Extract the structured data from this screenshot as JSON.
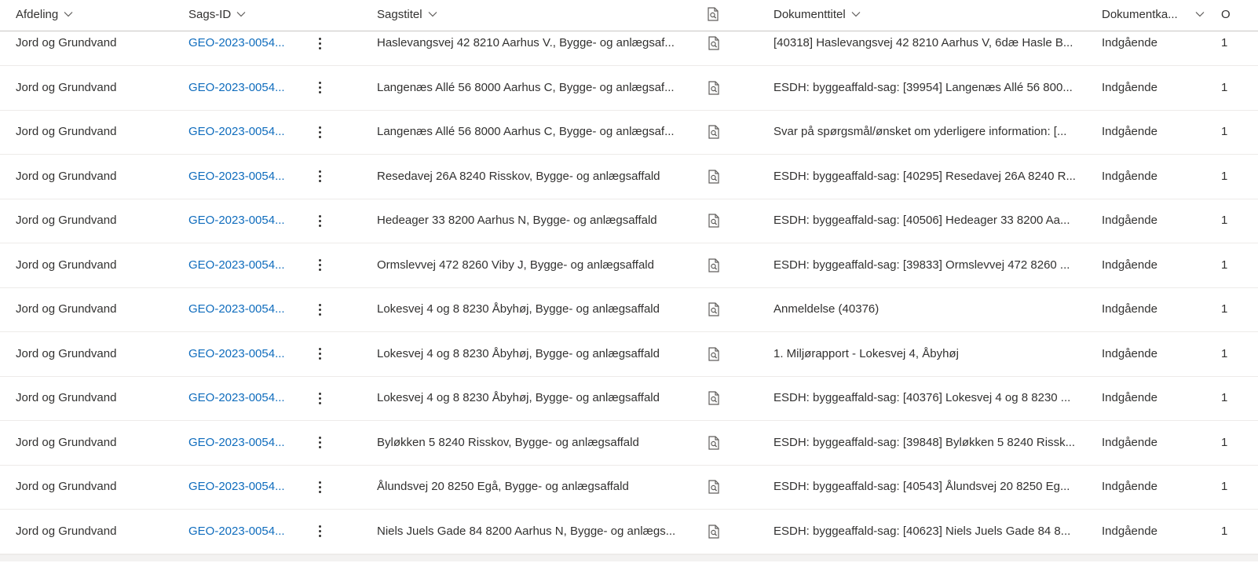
{
  "columns": {
    "afdeling": "Afdeling",
    "sags_id": "Sags-ID",
    "sagstitel": "Sagstitel",
    "doc_icon": "document-search-icon",
    "dokumenttitel": "Dokumenttitel",
    "dokumentkategori": "Dokumentka...",
    "extra": "O"
  },
  "rows": [
    {
      "afdeling": "Jord og Grundvand",
      "sags_id": "GEO-2023-0054...",
      "sagstitel": "Haslevangsvej 42 8210 Aarhus V., Bygge- og anlægsaf...",
      "dokumenttitel": "[40318] Haslevangsvej 42 8210 Aarhus V, 6dæ Hasle B...",
      "dokumentkategori": "Indgående",
      "extra": "1"
    },
    {
      "afdeling": "Jord og Grundvand",
      "sags_id": "GEO-2023-0054...",
      "sagstitel": "Langenæs Allé 56 8000 Aarhus C, Bygge- og anlægsaf...",
      "dokumenttitel": "ESDH: byggeaffald-sag: [39954] Langenæs Allé 56 800...",
      "dokumentkategori": "Indgående",
      "extra": "1"
    },
    {
      "afdeling": "Jord og Grundvand",
      "sags_id": "GEO-2023-0054...",
      "sagstitel": "Langenæs Allé 56 8000 Aarhus C, Bygge- og anlægsaf...",
      "dokumenttitel": "Svar på spørgsmål/ønsket om yderligere information: [...",
      "dokumentkategori": "Indgående",
      "extra": "1"
    },
    {
      "afdeling": "Jord og Grundvand",
      "sags_id": "GEO-2023-0054...",
      "sagstitel": "Resedavej 26A 8240 Risskov, Bygge- og anlægsaffald",
      "dokumenttitel": "ESDH: byggeaffald-sag: [40295] Resedavej 26A 8240 R...",
      "dokumentkategori": "Indgående",
      "extra": "1"
    },
    {
      "afdeling": "Jord og Grundvand",
      "sags_id": "GEO-2023-0054...",
      "sagstitel": "Hedeager 33 8200 Aarhus N, Bygge- og anlægsaffald",
      "dokumenttitel": "ESDH: byggeaffald-sag: [40506] Hedeager 33 8200 Aa...",
      "dokumentkategori": "Indgående",
      "extra": "1"
    },
    {
      "afdeling": "Jord og Grundvand",
      "sags_id": "GEO-2023-0054...",
      "sagstitel": "Ormslevvej 472 8260 Viby J, Bygge- og anlægsaffald",
      "dokumenttitel": "ESDH: byggeaffald-sag: [39833] Ormslevvej 472 8260 ...",
      "dokumentkategori": "Indgående",
      "extra": "1"
    },
    {
      "afdeling": "Jord og Grundvand",
      "sags_id": "GEO-2023-0054...",
      "sagstitel": "Lokesvej 4 og 8 8230 Åbyhøj, Bygge- og anlægsaffald",
      "dokumenttitel": "Anmeldelse (40376)",
      "dokumentkategori": "Indgående",
      "extra": "1"
    },
    {
      "afdeling": "Jord og Grundvand",
      "sags_id": "GEO-2023-0054...",
      "sagstitel": "Lokesvej 4 og 8 8230 Åbyhøj, Bygge- og anlægsaffald",
      "dokumenttitel": "1. Miljørapport - Lokesvej 4, Åbyhøj",
      "dokumentkategori": "Indgående",
      "extra": "1"
    },
    {
      "afdeling": "Jord og Grundvand",
      "sags_id": "GEO-2023-0054...",
      "sagstitel": "Lokesvej 4 og 8 8230 Åbyhøj, Bygge- og anlægsaffald",
      "dokumenttitel": "ESDH: byggeaffald-sag: [40376] Lokesvej 4 og 8 8230 ...",
      "dokumentkategori": "Indgående",
      "extra": "1"
    },
    {
      "afdeling": "Jord og Grundvand",
      "sags_id": "GEO-2023-0054...",
      "sagstitel": "Byløkken 5 8240 Risskov, Bygge- og anlægsaffald",
      "dokumenttitel": "ESDH: byggeaffald-sag: [39848] Byløkken 5 8240 Rissk...",
      "dokumentkategori": "Indgående",
      "extra": "1"
    },
    {
      "afdeling": "Jord og Grundvand",
      "sags_id": "GEO-2023-0054...",
      "sagstitel": "Ålundsvej 20 8250 Egå, Bygge- og anlægsaffald",
      "dokumenttitel": "ESDH: byggeaffald-sag: [40543] Ålundsvej 20 8250 Eg...",
      "dokumentkategori": "Indgående",
      "extra": "1"
    },
    {
      "afdeling": "Jord og Grundvand",
      "sags_id": "GEO-2023-0054...",
      "sagstitel": "Niels Juels Gade 84 8200 Aarhus N, Bygge- og anlægs...",
      "dokumenttitel": "ESDH: byggeaffald-sag: [40623] Niels Juels Gade 84 8...",
      "dokumentkategori": "Indgående",
      "extra": "1"
    }
  ]
}
